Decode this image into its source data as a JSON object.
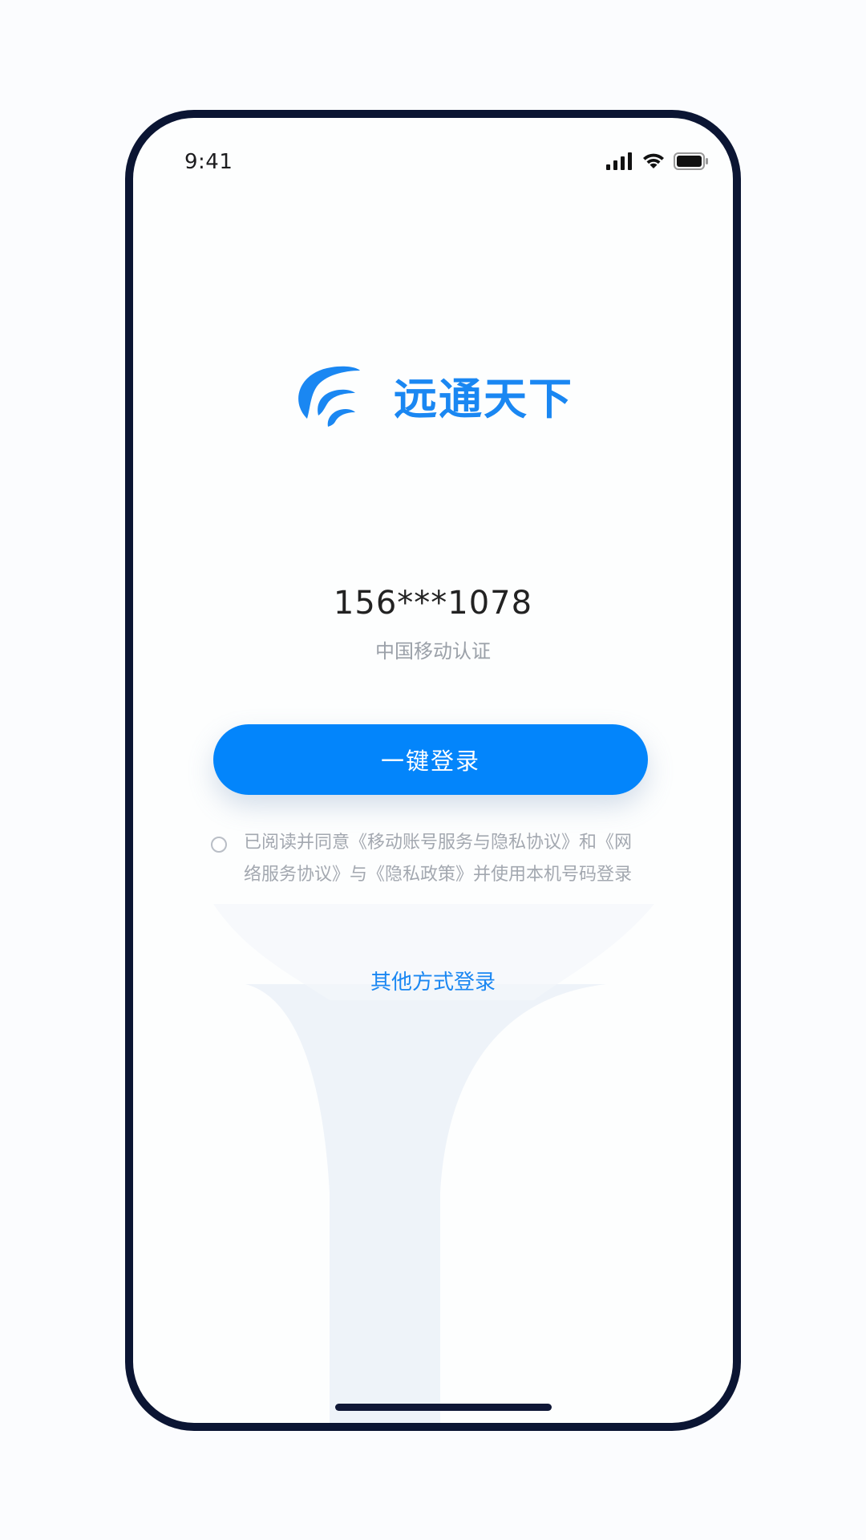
{
  "status_bar": {
    "time": "9:41",
    "icons": [
      "cellular-signal-icon",
      "wifi-icon",
      "battery-icon"
    ]
  },
  "brand": {
    "logo_icon": "brand-logo-icon",
    "name": "远通天下",
    "color": "#1a87f2"
  },
  "account": {
    "phone_number": "156***1078",
    "carrier_label": "中国移动认证"
  },
  "actions": {
    "one_click_login": "一键登录",
    "other_login": "其他方式登录",
    "button_color": "#0385fb"
  },
  "agreement": {
    "checked": false,
    "text": "已阅读并同意《移动账号服务与隐私协议》和《网络服务协议》与《隐私政策》并使用本机号码登录"
  }
}
